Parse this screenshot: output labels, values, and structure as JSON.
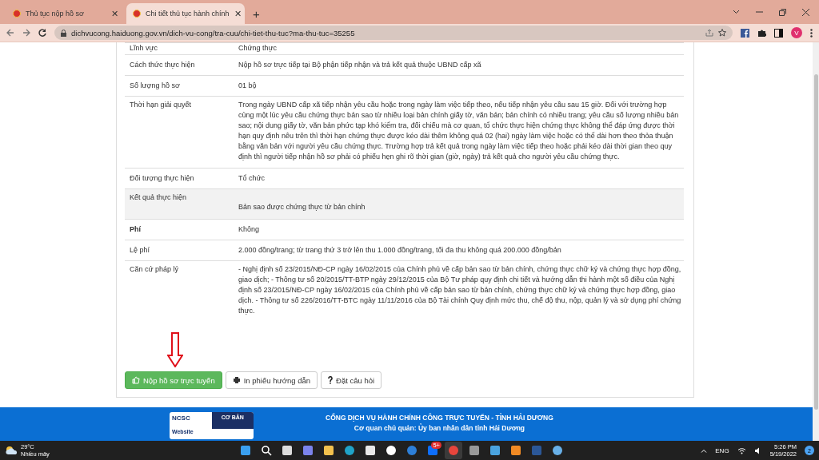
{
  "browser": {
    "tabs": [
      {
        "title": "Thủ tục nộp hồ sơ",
        "selected": false
      },
      {
        "title": "Chi tiết thủ tục hành chính",
        "selected": true
      }
    ],
    "tab_close": "✕",
    "new_tab": "+",
    "url": "dichvucong.haiduong.gov.vn/dich-vu-cong/tra-cuu/chi-tiet-thu-tuc?ma-thu-tuc=35255",
    "profile": "V"
  },
  "details": [
    {
      "label": "Lĩnh vực",
      "value": "Chứng thực",
      "shaded": false,
      "strong": false
    },
    {
      "label": "Cách thức thực hiện",
      "value": "Nộp hồ sơ trực tiếp tại Bộ phận tiếp nhận và trả kết quả thuộc UBND cấp xã",
      "shaded": false,
      "strong": false
    },
    {
      "label": "Số lượng hồ sơ",
      "value": "01 bộ",
      "shaded": false,
      "strong": false
    },
    {
      "label": "Thời hạn giải quyết",
      "value": "Trong ngày UBND cấp xã tiếp nhận yêu cầu hoặc trong ngày làm việc tiếp theo, nếu tiếp nhận yêu cầu sau 15 giờ. Đối với trường hợp cùng một lúc yêu cầu chứng thực bản sao từ nhiều loại bản chính giấy tờ, văn bản; bản chính có nhiều trang; yêu cầu số lượng nhiều bản sao; nội dung giấy tờ, văn bản phức tạp khó kiểm tra, đối chiếu mà cơ quan, tổ chức thực hiện chứng thực không thể đáp ứng được thời hạn quy định nêu trên thì thời hạn chứng thực được kéo dài thêm không quá 02 (hai) ngày làm việc hoặc có thể dài hơn theo thỏa thuận bằng văn bản với người yêu cầu chứng thực. Trường hợp trả kết quả trong ngày làm việc tiếp theo hoặc phải kéo dài thời gian theo quy định thì người tiếp nhận hồ sơ phải có phiếu hẹn ghi rõ thời gian (giờ, ngày) trả kết quả cho người yêu cầu chứng thực.",
      "shaded": false,
      "strong": false
    },
    {
      "label": "Đối tượng thực hiện",
      "value": "Tổ chức",
      "shaded": false,
      "strong": false
    },
    {
      "label": "Kết quả thực hiện",
      "value": "Bản sao được chứng thực từ bản chính",
      "shaded": true,
      "strong": false
    },
    {
      "label": "Phí",
      "value": "Không",
      "shaded": false,
      "strong": true
    },
    {
      "label": "Lệ phí",
      "value": "2.000 đồng/trang; từ trang thứ 3 trở lên thu 1.000 đồng/trang, tối đa thu không quá 200.000 đồng/bản",
      "shaded": false,
      "strong": false
    },
    {
      "label": "Căn cứ pháp lý",
      "value": "- Nghị định số 23/2015/NĐ-CP ngày 16/02/2015 của Chính phủ về cấp bản sao từ bản chính, chứng thực chữ ký và chứng thực hợp đồng, giao dịch; - Thông tư số 20/2015/TT-BTP ngày 29/12/2015 của Bộ Tư pháp quy định chi tiết và hướng dẫn thi hành một số điều của Nghị định số 23/2015/NĐ-CP ngày 16/02/2015 của Chính phủ về cấp bản sao từ bản chính, chứng thực chữ ký và chứng thực hợp đồng, giao dịch. - Thông tư số 226/2016/TT-BTC ngày 11/11/2016 của Bộ Tài chính Quy định mức thu, chế độ thu, nộp, quản lý và sử dụng phí chứng thực.",
      "shaded": false,
      "strong": false
    }
  ],
  "actions": [
    {
      "label": "Nộp hồ sơ trực tuyến",
      "kind": "submit"
    },
    {
      "label": "In phiếu hướng dẫn",
      "kind": "print"
    },
    {
      "label": "Đặt câu hỏi",
      "kind": "question"
    }
  ],
  "footer": {
    "badge_brand": "NCSC",
    "badge_level": "CƠ BẢN",
    "badge_text": "Website",
    "title": "CỔNG DỊCH VỤ HÀNH CHÍNH CÔNG TRỰC TUYẾN - TỈNH HẢI DƯƠNG",
    "owner": "Cơ quan chủ quản: Ủy ban nhân dân tỉnh Hải Dương"
  },
  "taskbar": {
    "temperature": "29°C",
    "weather": "Nhiều mây",
    "apps": [
      {
        "kind": "start",
        "selected": false
      },
      {
        "kind": "search",
        "selected": false
      },
      {
        "kind": "taskview",
        "selected": false
      },
      {
        "kind": "chat",
        "selected": false
      },
      {
        "kind": "folder",
        "selected": false
      },
      {
        "kind": "edge",
        "selected": false
      },
      {
        "kind": "store",
        "selected": false
      },
      {
        "kind": "circle",
        "selected": false
      },
      {
        "kind": "help",
        "selected": false
      },
      {
        "kind": "zalo",
        "selected": false,
        "badge": "5+"
      },
      {
        "kind": "chrome",
        "selected": true
      },
      {
        "kind": "disk",
        "selected": false
      },
      {
        "kind": "photos",
        "selected": false
      },
      {
        "kind": "orange",
        "selected": false
      },
      {
        "kind": "word",
        "selected": false
      },
      {
        "kind": "paint",
        "selected": false
      }
    ],
    "language": "ENG",
    "time": "5:26 PM",
    "date": "5/19/2022",
    "notifications": "2"
  }
}
